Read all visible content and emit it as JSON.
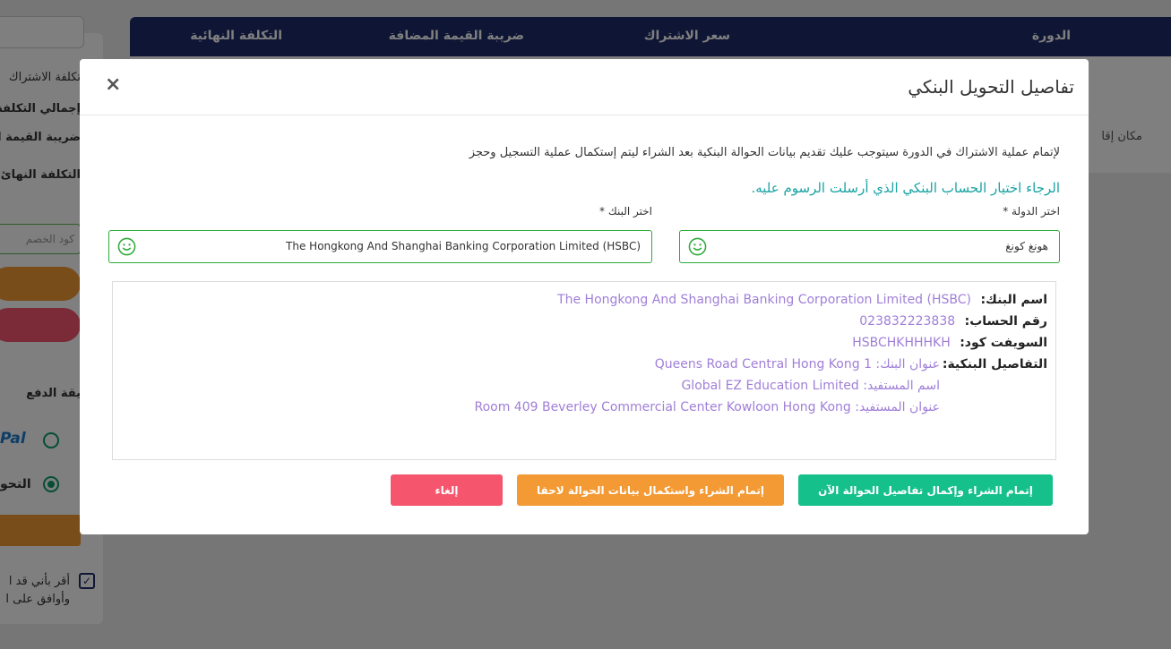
{
  "background": {
    "table_headers": [
      "الدورة",
      "سعر الاشتراك",
      "ضريبة القيمة المضافة",
      "التكلفة النهائية"
    ],
    "venue": "مكان إقا",
    "summary_lines": [
      "تكلفة الاشتراك",
      "إجمالي التكلفة",
      "ضريبة القيمة ال",
      "التكلفة النهائ"
    ],
    "discount_placeholder": "كود الخصم",
    "payment_label": "يقة الدفع",
    "paypal_label": "Pal",
    "transfer_label": "التحو",
    "agree_line1": "أقر بأني قد ا",
    "agree_line2": "وأوافق على ا",
    "colors": {
      "header": "#1f2d6b",
      "orange": "#f39a35",
      "pink": "#f5566e"
    }
  },
  "modal": {
    "title": "تفاصيل التحويل البنكي",
    "close_glyph": "×",
    "intro": "لإتمام عملية الاشتراك في الدورة سيتوجب عليك تقديم بيانات الحوالة البنكية بعد الشراء ليتم إستكمال عملية التسجيل وحجز",
    "select_prompt": "الرجاء اختيار الحساب البنكي الذي أرسلت الرسوم عليه.",
    "country_label": "اختر الدولة *",
    "country_value": "هونغ كونغ",
    "bank_label": "اختر البنك *",
    "bank_value": "The Hongkong And Shanghai Banking Corporation Limited (HSBC)",
    "details": {
      "bank_name_label": "اسم البنك:",
      "bank_name": "The Hongkong And Shanghai Banking Corporation Limited (HSBC)",
      "account_label": "رقم الحساب:",
      "account": "023832223838",
      "swift_label": "السويفت كود:",
      "swift": "HSBCHKHHHKH",
      "bank_details_label": "التفاصيل البنكية:",
      "bank_address": "عنوان البنك: 1 Queens Road Central Hong Kong",
      "beneficiary_name": "اسم المستفيد: Global EZ Education Limited",
      "beneficiary_address": "عنوان المستفيد: Room 409 Beverley Commercial Center Kowloon Hong Kong"
    },
    "buttons": {
      "complete_now": "إتمام الشراء وإكمال تفاصيل الحوالة الآن",
      "complete_later": "إتمام الشراء واستكمال بيانات الحوالة لاحقا",
      "cancel": "إلغاء"
    },
    "colors": {
      "green": "#16c08a",
      "orange": "#f39a35",
      "red": "#f5566e",
      "teal": "#1aa3a3",
      "value": "#a07fd8"
    }
  }
}
